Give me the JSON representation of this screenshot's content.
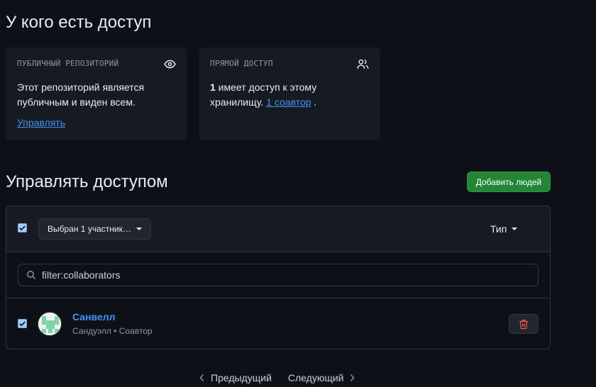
{
  "page": {
    "title": "У кого есть доступ"
  },
  "public_card": {
    "title": "ПУБЛИЧНЫЙ РЕПОЗИТОРИЙ",
    "icon": "eye-icon",
    "text": "Этот репозиторий является публичным и виден всем.",
    "link": "Управлять"
  },
  "direct_card": {
    "title": "ПРЯМОЙ ДОСТУП",
    "icon": "people-icon",
    "count": "1",
    "text_a": " имеет доступ к этому хранилищу.",
    "link": "1 соавтор",
    "text_b": " ."
  },
  "manage": {
    "title": "Управлять доступом",
    "add_button": "Добавить людей",
    "select_label": "Выбран 1 участник…",
    "type_label": "Тип",
    "filter_value": "filter:collaborators",
    "header_checked": true
  },
  "members": [
    {
      "name": "Санвелл",
      "subtitle": "Сандуэлл • Соавтор",
      "checked": true,
      "avatar": "identicon"
    }
  ],
  "pagination": {
    "prev": "Предыдущий",
    "next": "Следующий"
  },
  "colors": {
    "background": "#0d1117",
    "card": "#161b22",
    "accent_link": "#4493f8",
    "primary_button": "#238636",
    "danger": "#f85149"
  }
}
